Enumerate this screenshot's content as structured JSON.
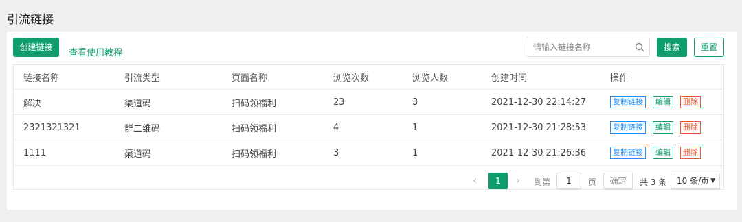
{
  "page": {
    "title": "引流链接"
  },
  "toolbar": {
    "create_label": "创建链接",
    "tutorial_label": "查看使用教程",
    "search_placeholder": "请输入链接名称",
    "search_value": "",
    "search_label": "搜索",
    "reset_label": "重置"
  },
  "table": {
    "headers": [
      "链接名称",
      "引流类型",
      "页面名称",
      "浏览次数",
      "浏览人数",
      "创建时间",
      "操作"
    ],
    "rows": [
      {
        "name": "解决",
        "type": "渠道码",
        "page": "扫码领福利",
        "views": "23",
        "visitors": "3",
        "created": "2021-12-30 22:14:27"
      },
      {
        "name": "2321321321",
        "type": "群二维码",
        "page": "扫码领福利",
        "views": "4",
        "visitors": "1",
        "created": "2021-12-30 21:28:53"
      },
      {
        "name": "1111",
        "type": "渠道码",
        "page": "扫码领福利",
        "views": "3",
        "visitors": "1",
        "created": "2021-12-30 21:26:36"
      }
    ],
    "actions": {
      "copy": "复制链接",
      "edit": "编辑",
      "delete": "删除"
    }
  },
  "pagination": {
    "current_page": "1",
    "goto_label": "到第",
    "goto_value": "1",
    "page_suffix": "页",
    "confirm_label": "确定",
    "total": "共 3 条",
    "page_size": "10 条/页"
  },
  "colors": {
    "primary": "#0f9d6e",
    "link": "#1e90ff",
    "danger": "#e8552f"
  },
  "icons": {
    "search": "search-icon",
    "prev": "chevron-left-icon",
    "next": "chevron-right-icon",
    "dropdown": "caret-down-icon"
  }
}
